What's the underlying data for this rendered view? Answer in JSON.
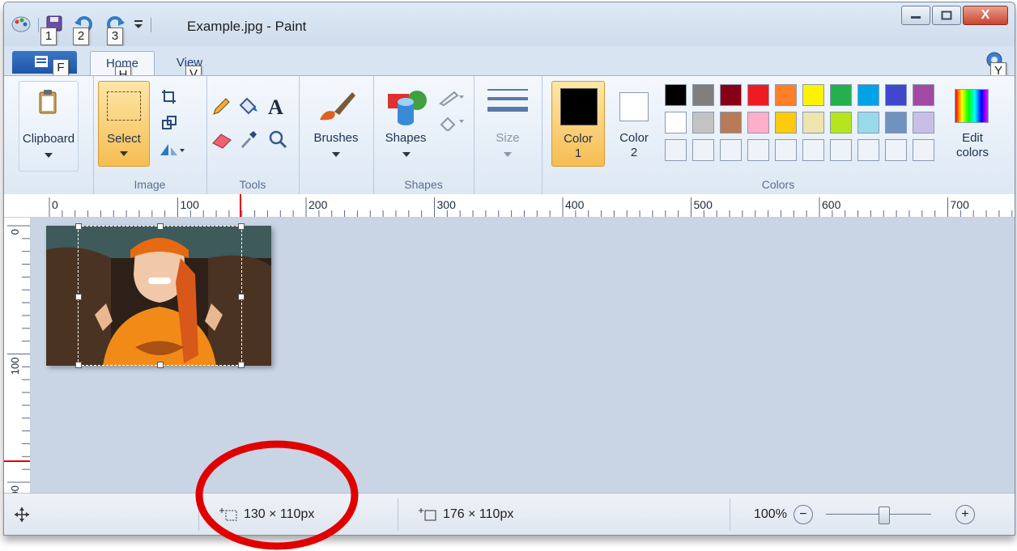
{
  "window": {
    "title": "Example.jpg - Paint",
    "close_glyph": "X"
  },
  "qat": {
    "keytips": [
      "1",
      "2",
      "3"
    ]
  },
  "tabs": [
    {
      "label": "Home",
      "keytip": "H"
    },
    {
      "label": "View",
      "keytip": "V"
    }
  ],
  "file_keytip": "F",
  "help_keytip": "Y",
  "ribbon": {
    "clipboard": {
      "label": "Clipboard"
    },
    "image": {
      "select_label": "Select",
      "group_label": "Image"
    },
    "tools": {
      "group_label": "Tools",
      "text_glyph": "A"
    },
    "brushes": {
      "label": "Brushes"
    },
    "shapes": {
      "label": "Shapes",
      "group_label": "Shapes"
    },
    "size": {
      "label": "Size"
    },
    "color1": {
      "label_line1": "Color",
      "label_line2": "1",
      "value": "#000000"
    },
    "color2": {
      "label_line1": "Color",
      "label_line2": "2",
      "value": "#ffffff"
    },
    "colors": {
      "group_label": "Colors",
      "row1": [
        "#000000",
        "#7f7f7f",
        "#880015",
        "#ed1c24",
        "#ff7f27",
        "#fff200",
        "#22b14c",
        "#00a2e8",
        "#3f48cc",
        "#a349a4"
      ],
      "row2": [
        "#ffffff",
        "#c3c3c3",
        "#b97a57",
        "#ffaec9",
        "#ffc90e",
        "#efe4b0",
        "#b5e61d",
        "#99d9ea",
        "#7092be",
        "#c8bfe7"
      ]
    },
    "edit_colors": {
      "label_line1": "Edit",
      "label_line2": "colors"
    }
  },
  "ruler": {
    "h_labels": [
      "0",
      "100",
      "200",
      "300",
      "400",
      "500",
      "600",
      "700"
    ],
    "v_labels": [
      "0",
      "100",
      "00"
    ]
  },
  "status": {
    "selection_size": "130 × 110px",
    "image_size": "176 × 110px",
    "zoom": "100%",
    "zoom_out_glyph": "−",
    "zoom_in_glyph": "+",
    "zoom_value": 100
  },
  "colors": {
    "accent_orange": "#f9c96a",
    "annotation_red": "#e10000"
  }
}
